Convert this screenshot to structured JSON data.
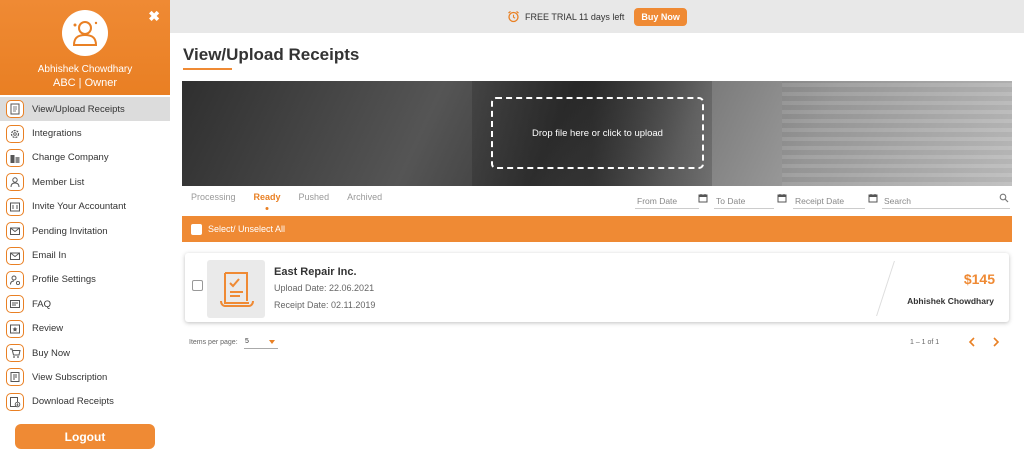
{
  "profile": {
    "name": "Abhishek Chowdhary",
    "role": "ABC | Owner",
    "close_label": "✖"
  },
  "sidebar": {
    "items": [
      {
        "label": "View/Upload Receipts",
        "icon": "receipt-icon"
      },
      {
        "label": "Integrations",
        "icon": "gear-icon"
      },
      {
        "label": "Change Company",
        "icon": "building-icon"
      },
      {
        "label": "Member List",
        "icon": "member-icon"
      },
      {
        "label": "Invite Your Accountant",
        "icon": "accountant-icon"
      },
      {
        "label": "Pending Invitation",
        "icon": "invitation-icon"
      },
      {
        "label": "Email In",
        "icon": "mail-icon"
      },
      {
        "label": "Profile Settings",
        "icon": "profile-settings-icon"
      },
      {
        "label": "FAQ",
        "icon": "faq-icon"
      },
      {
        "label": "Review",
        "icon": "review-icon"
      },
      {
        "label": "Buy Now",
        "icon": "cart-icon"
      },
      {
        "label": "View Subscription",
        "icon": "subscription-icon"
      },
      {
        "label": "Download Receipts",
        "icon": "download-icon"
      }
    ],
    "logout_label": "Logout"
  },
  "topbar": {
    "trial_text": "FREE TRIAL 11 days left",
    "buy_label": "Buy Now"
  },
  "main": {
    "title": "View/Upload Receipts",
    "dropzone_text": "Drop file here or click to upload",
    "tabs": [
      "Processing",
      "Ready",
      "Pushed",
      "Archived"
    ],
    "active_tab": "Ready",
    "filters": {
      "from_date": "From Date",
      "to_date": "To Date",
      "receipt_date": "Receipt Date",
      "search": "Search"
    },
    "select_all_label": "Select/ Unselect All",
    "receipts": [
      {
        "vendor": "East Repair Inc.",
        "upload_date": "Upload Date: 22.06.2021",
        "receipt_date": "Receipt Date: 02.11.2019",
        "amount": "$145",
        "owner": "Abhishek Chowdhary"
      }
    ],
    "pagination": {
      "items_label": "Items per page:",
      "items_value": "5",
      "range": "1 – 1 of 1"
    }
  },
  "colors": {
    "accent": "#ef8a34",
    "active_item_bg": "#dcdcdc",
    "topbar_bg": "#e8e8e8"
  }
}
